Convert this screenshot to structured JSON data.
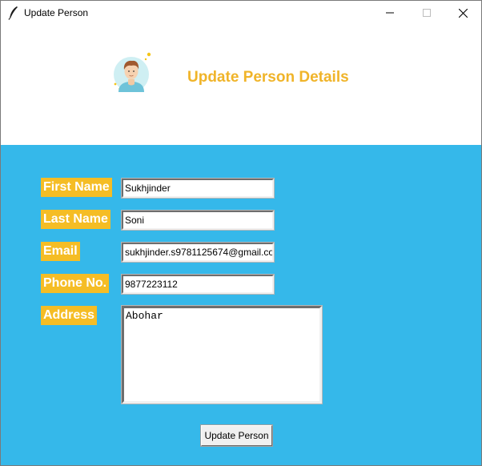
{
  "window": {
    "title": "Update Person",
    "controls": [
      "minimize",
      "maximize",
      "close"
    ]
  },
  "header": {
    "title": "Update Person Details",
    "title_color": "#f0b429"
  },
  "form": {
    "background_color": "#35b8ea",
    "label_color": "#f5bd25",
    "fields": {
      "first_name": {
        "label": "First Name",
        "value": "Sukhjinder"
      },
      "last_name": {
        "label": "Last Name",
        "value": "Soni"
      },
      "email": {
        "label": "Email",
        "value": "sukhjinder.s9781125674@gmail.co"
      },
      "phone": {
        "label": "Phone No.",
        "value": "9877223112"
      },
      "address": {
        "label": "Address",
        "value": "Abohar"
      }
    },
    "submit_label": "Update Person"
  }
}
